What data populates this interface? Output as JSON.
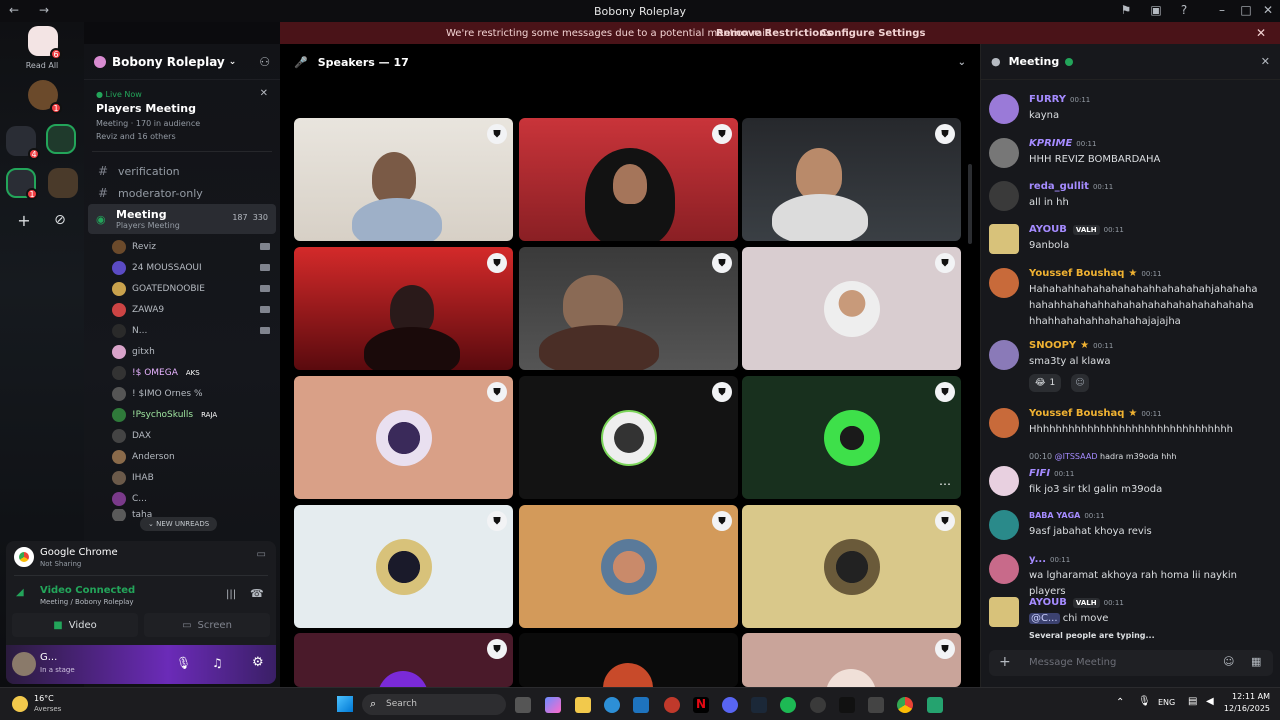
{
  "window": {
    "title": "Bobony Roleplay"
  },
  "banner": {
    "message": "We're restricting some messages due to a potential mention raid",
    "remove": "Remove Restrictions",
    "configure": "Configure Settings"
  },
  "servers": {
    "read_all": "Read All",
    "badges": [
      "6",
      "1",
      "4",
      "1"
    ]
  },
  "guild": {
    "name": "Bobony Roleplay"
  },
  "live": {
    "tag": "Live Now",
    "title": "Players Meeting",
    "channel": "Meeting",
    "audience": "170 in audience",
    "others": "Reviz and 16 others"
  },
  "channels": [
    {
      "name": "verification"
    },
    {
      "name": "moderator-only"
    }
  ],
  "meeting_channel": {
    "name": "Meeting",
    "sub": "Players Meeting",
    "count_a": "187",
    "count_b": "330"
  },
  "members": [
    {
      "name": "Reviz",
      "tag": ""
    },
    {
      "name": "24 MOUSSAOUI",
      "tag": ""
    },
    {
      "name": "GOATEDNOOBIE",
      "tag": ""
    },
    {
      "name": "ZAWA9",
      "tag": ""
    },
    {
      "name": "N...",
      "tag": ""
    },
    {
      "name": "gitxh",
      "tag": ""
    },
    {
      "name": "!$ OMEGA",
      "tag": "AKS"
    },
    {
      "name": "! $IMO Ornes %",
      "tag": ""
    },
    {
      "name": "!PsychoSkulls",
      "tag": "RAJA"
    },
    {
      "name": "DAX",
      "tag": ""
    },
    {
      "name": "Anderson",
      "tag": ""
    },
    {
      "name": "IHAB",
      "tag": ""
    },
    {
      "name": "C...",
      "tag": ""
    },
    {
      "name": "taha",
      "tag": ""
    }
  ],
  "new_unreads": "NEW UNREADS",
  "panel": {
    "app": "Google Chrome",
    "app_status": "Not Sharing",
    "connection": "Video Connected",
    "location": "Meeting",
    "location_guild": "/ Bobony Roleplay",
    "video_btn": "Video",
    "screen_btn": "Screen",
    "user": "G...",
    "user_status": "In a stage"
  },
  "stage": {
    "speakers_label": "Speakers — 17"
  },
  "chat": {
    "title": "Meeting",
    "input_placeholder": "Message Meeting",
    "typing": "Several people are typing...",
    "messages": [
      {
        "name": "FURRY",
        "time": "00:11",
        "text": "kayna",
        "color": "#a58bff"
      },
      {
        "name": "KPRIME",
        "time": "00:11",
        "text": "HHH REVIZ BOMBARDAHA",
        "color": "#a58bff"
      },
      {
        "name": "reda_gullit",
        "time": "00:11",
        "text": "all in hh",
        "color": "#a58bff"
      },
      {
        "name": "AYOUB",
        "time": "00:11",
        "text": "9anbola",
        "color": "#a58bff",
        "tag": "VALH"
      },
      {
        "name": "Youssef Boushaq",
        "time": "00:11",
        "text": "Hahahahhahahahahahahhahahahahjahahahahahahhahahahhahahahahahahahahahahahahhahhahahahhahahahajajajha",
        "color": "#f0b232"
      },
      {
        "name": "SNOOPY",
        "time": "00:11",
        "text": "sma3ty al klawa",
        "color": "#f0b232",
        "reaction": "1"
      },
      {
        "name": "Youssef Boushaq",
        "time": "00:11",
        "text": "Hhhhhhhhhhhhhhhhhhhhhhhhhhhhhhhh",
        "color": "#f0b232"
      },
      {
        "name": "FIFI",
        "time": "00:11",
        "text": "fik jo3 sir tkl galin m39oda",
        "color": "#a58bff",
        "reply_time": "00:10",
        "reply_user": "@ITSSAAD",
        "reply_text": "hadra m39oda hhh"
      },
      {
        "name": "BABA YAGA",
        "time": "00:11",
        "text": "9asf jabahat khoya revis",
        "color": "#a58bff"
      },
      {
        "name": "y...",
        "time": "00:11",
        "text": "wa lgharamat akhoya rah homa lii naykin players",
        "color": "#a58bff"
      },
      {
        "name": "AYOUB",
        "time": "00:11",
        "text": "chi move",
        "color": "#a58bff",
        "tag": "VALH",
        "mention": "@C..."
      }
    ]
  },
  "taskbar": {
    "temp": "16°C",
    "weather": "Averses",
    "search": "Search",
    "lang": "ENG",
    "time": "12:11 AM",
    "date": "12/16/2025"
  }
}
